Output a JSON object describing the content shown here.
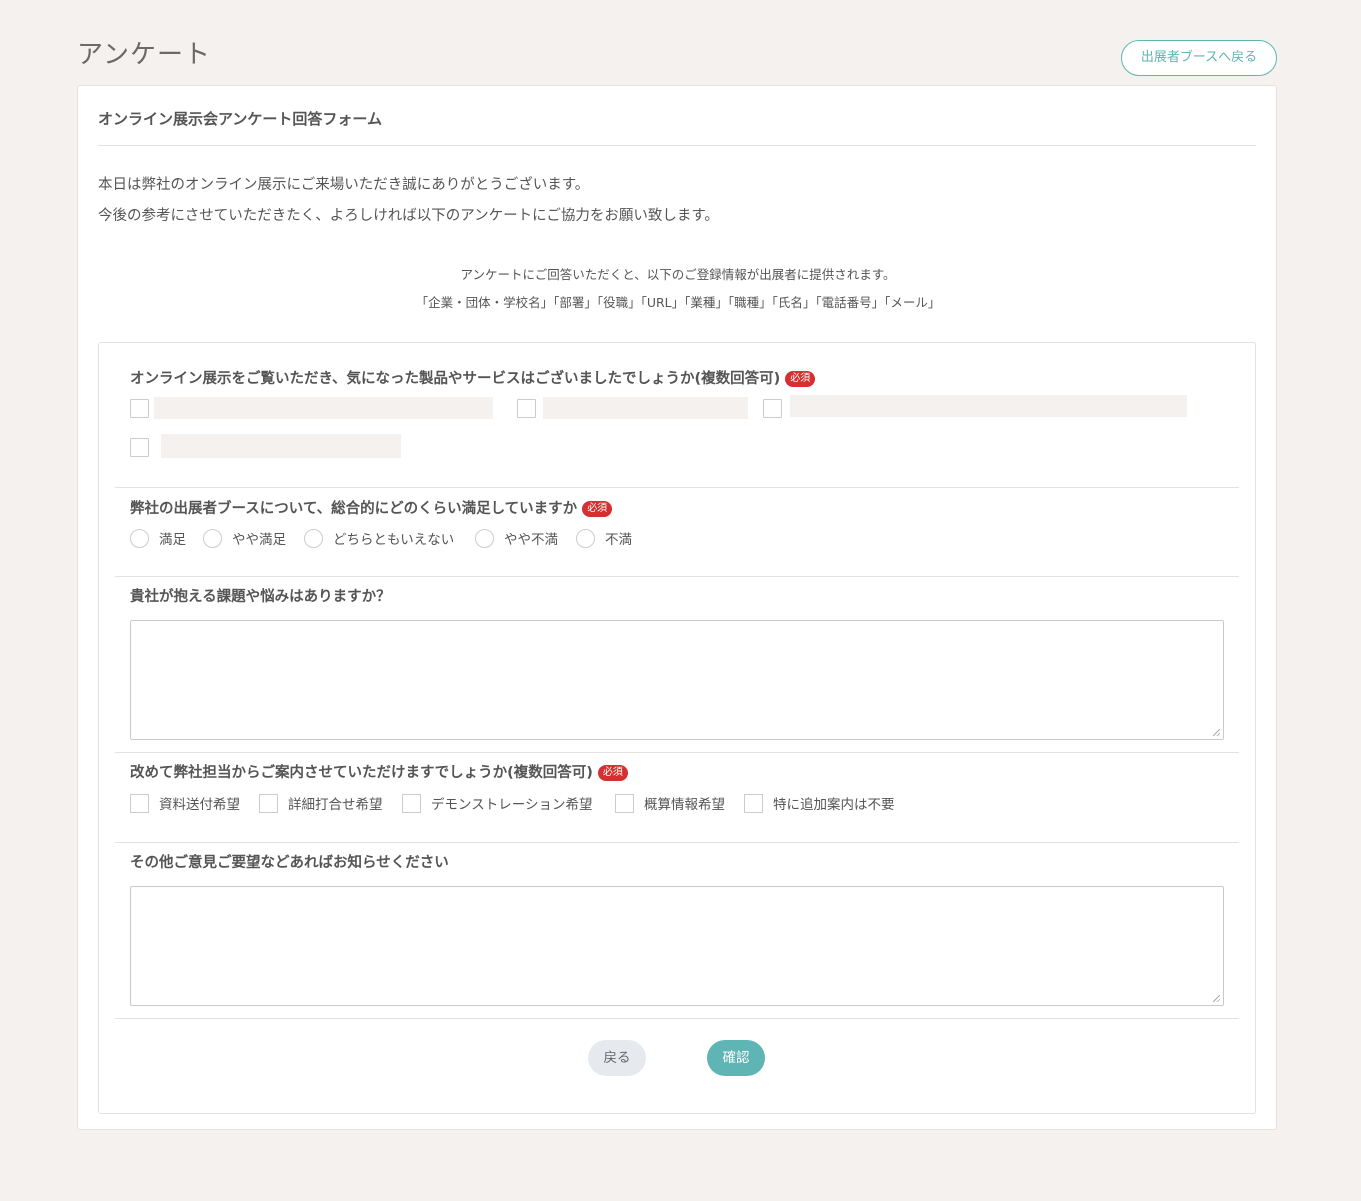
{
  "page": {
    "title": "アンケート",
    "back_to_booth": "出展者ブースへ戻る"
  },
  "form": {
    "title": "オンライン展示会アンケート回答フォーム",
    "intro_line1": "本日は弊社のオンライン展示にご来場いただき誠にありがとうございます。",
    "intro_line2": "今後の参考にさせていただきたく、よろしければ以下のアンケートにご協力をお願い致します。",
    "notice_line1": "アンケートにご回答いただくと、以下のご登録情報が出展者に提供されます。",
    "notice_line2": "「企業・団体・学校名」「部署」「役職」「URL」「業種」「職種」「氏名」「電話番号」「メール」",
    "required_label": "必須"
  },
  "questions": {
    "q1": {
      "title": "オンライン展示をご覧いただき、気になった製品やサービスはございましたでしょうか(複数回答可)"
    },
    "q2": {
      "title": "弊社の出展者ブースについて、総合的にどのくらい満足していますか",
      "options": [
        "満足",
        "やや満足",
        "どちらともいえない",
        "やや不満",
        "不満"
      ]
    },
    "q3": {
      "title": "貴社が抱える課題や悩みはありますか？"
    },
    "q4": {
      "title": "改めて弊社担当からご案内させていただけますでしょうか(複数回答可)",
      "options": [
        "資料送付希望",
        "詳細打合せ希望",
        "デモンストレーション希望",
        "概算情報希望",
        "特に追加案内は不要"
      ]
    },
    "q5": {
      "title": "その他ご意見ご要望などあればお知らせください"
    }
  },
  "buttons": {
    "back": "戻る",
    "confirm": "確認"
  },
  "colors": {
    "accent": "#5eb5b3",
    "required_badge": "#d62f2f",
    "page_background": "#f4f1ee"
  }
}
